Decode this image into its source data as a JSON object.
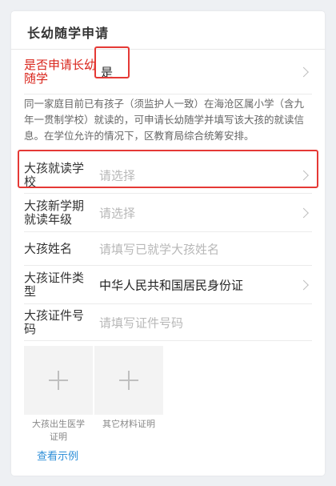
{
  "card": {
    "title": "长幼随学申请"
  },
  "fields": {
    "apply": {
      "label": "是否申请长幼随学",
      "value": "是"
    },
    "description": "同一家庭目前已有孩子（须监护人一致）在海沧区属小学（含九年一贯制学校）就读的，可申请长幼随学并填写该大孩的就读信息。在学位允许的情况下，区教育局综合统筹安排。",
    "school": {
      "label": "大孩就读学校",
      "placeholder": "请选择"
    },
    "grade": {
      "label": "大孩新学期就读年级",
      "placeholder": "请选择"
    },
    "name": {
      "label": "大孩姓名",
      "placeholder": "请填写已就学大孩姓名"
    },
    "id_type": {
      "label": "大孩证件类型",
      "value": "中华人民共和国居民身份证"
    },
    "id_number": {
      "label": "大孩证件号码",
      "placeholder": "请填写证件号码"
    }
  },
  "uploads": [
    {
      "caption": "大孩出生医学证明"
    },
    {
      "caption": "其它材料证明"
    }
  ],
  "example_link": "查看示例",
  "colors": {
    "required_label": "#d9261c",
    "highlight": "#e53935",
    "link": "#2f8fd8"
  }
}
